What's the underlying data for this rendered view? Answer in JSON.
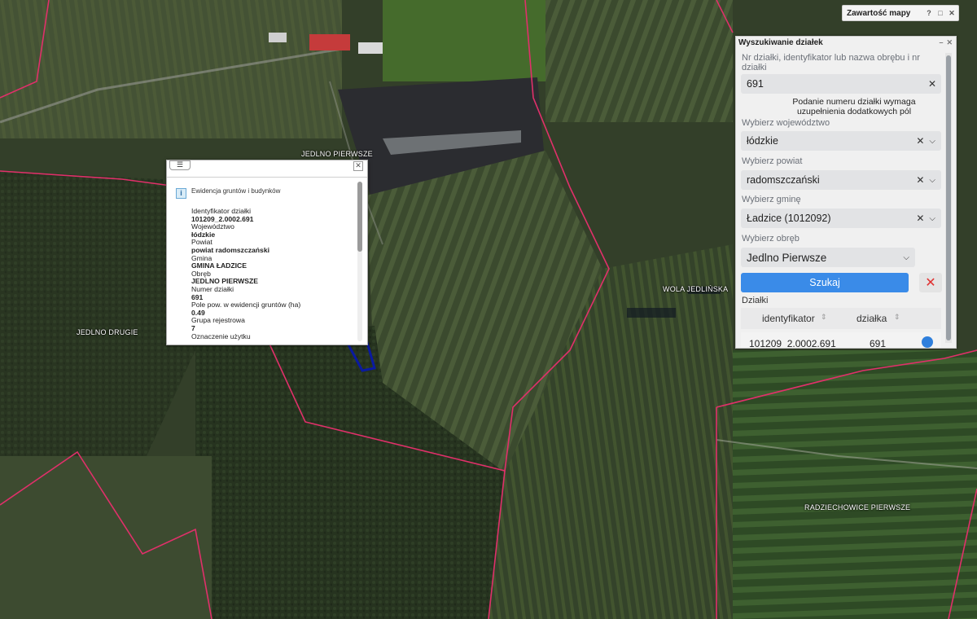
{
  "map": {
    "places": [
      {
        "id": "jedlno-pierwsze",
        "label": "JEDLNO PIERWSZE"
      },
      {
        "id": "wola-jedlinska",
        "label": "WOLA JEDLIŃSKA"
      },
      {
        "id": "jedlno-drugie",
        "label": "JEDLNO DRUGIE"
      },
      {
        "id": "radziechowice-pierwsze",
        "label": "RADZIECHOWICE PIERWSZE"
      }
    ],
    "boundary_color": "#e0306a",
    "parcel_outline_color": "#0a1aa0"
  },
  "map_content": {
    "title": "Zawartość mapy",
    "icons": [
      "help-icon",
      "restore-icon",
      "close-icon"
    ],
    "help_glyph": "?",
    "restore_glyph": "□",
    "close_glyph": "✕"
  },
  "search_panel": {
    "title": "Wyszukiwanie działek",
    "minimize_glyph": "–",
    "close_glyph": "✕",
    "parcel_field": {
      "label": "Nr działki, identyfikator lub nazwa obrębu i nr działki",
      "value": "691"
    },
    "note": "Podanie numeru działki wymaga uzupełnienia dodatkowych pól",
    "voivodeship": {
      "label": "Wybierz województwo",
      "value": "łódzkie"
    },
    "county": {
      "label": "Wybierz powiat",
      "value": "radomszczański"
    },
    "commune": {
      "label": "Wybierz gminę",
      "value": "Ładzice (1012092)"
    },
    "precinct": {
      "label": "Wybierz obręb",
      "value": "Jedlno Pierwsze"
    },
    "search_button": "Szukaj",
    "clear_glyph": "✕",
    "results": {
      "label": "Działki",
      "columns": [
        "identyfikator",
        "działka"
      ],
      "rows": [
        {
          "identyfikator": "101209_2.0002.691",
          "dzialka": "691"
        }
      ]
    },
    "accent": "#3a8be8"
  },
  "popup": {
    "title": "Ewidencja gruntów i budynków",
    "menu_glyph": "☰",
    "close_glyph": "✕",
    "info_glyph": "i",
    "fields": [
      {
        "label": "Identyfikator działki",
        "value": "101209_2.0002.691"
      },
      {
        "label": "Województwo",
        "value": "łódzkie"
      },
      {
        "label": "Powiat",
        "value": "powiat radomszczański"
      },
      {
        "label": "Gmina",
        "value": "GMINA ŁADZICE"
      },
      {
        "label": "Obręb",
        "value": "JEDLNO PIERWSZE"
      },
      {
        "label": "Numer działki",
        "value": "691"
      },
      {
        "label": "Pole pow. w ewidencji gruntów (ha)",
        "value": "0.49"
      },
      {
        "label": "Grupa rejestrowa",
        "value": "7"
      },
      {
        "label": "Oznaczenie użytku",
        "value": ""
      }
    ]
  }
}
